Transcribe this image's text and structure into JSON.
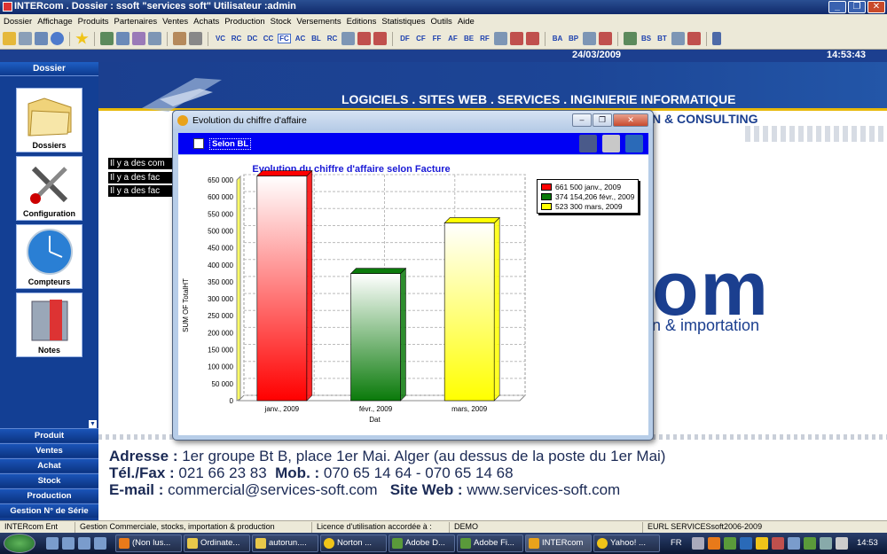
{
  "window": {
    "title": "INTERcom  . Dossier : ssoft  \"services soft\"  Utilisateur :admin",
    "controls": [
      "_",
      "❐",
      "✕"
    ]
  },
  "menu": [
    "Dossier",
    "Affichage",
    "Produits",
    "Partenaires",
    "Ventes",
    "Achats",
    "Production",
    "Stock",
    "Versements",
    "Editions",
    "Statistiques",
    "Outils",
    "Aide"
  ],
  "toolbar": {
    "labels": [
      "VC",
      "RC",
      "DC",
      "CC",
      "FC",
      "AC",
      "BL",
      "RC",
      "DF",
      "CF",
      "FF",
      "AF",
      "BE",
      "RF",
      "BA",
      "BP",
      "BS",
      "BT"
    ]
  },
  "header": {
    "date": "24/03/2009",
    "time": "14:53:43"
  },
  "sidebar": {
    "title": "Dossier",
    "tiles": [
      {
        "label": "Dossiers"
      },
      {
        "label": "Configuration"
      },
      {
        "label": "Compteurs"
      },
      {
        "label": "Notes"
      }
    ],
    "buttons": [
      "Produit",
      "Ventes",
      "Achat",
      "Stock",
      "Production",
      "Gestion N° de Série"
    ],
    "collapse": "▼"
  },
  "banner": {
    "slogan1": "LOGICIELS . SITES WEB . SERVICES . INGINIERIE INFORMATIQUE",
    "slogan2": "N & CONSULTING",
    "logo": "om",
    "subtitle": "n & importation"
  },
  "alerts": [
    "Il y a des com",
    "Il y a des fac",
    "Il y a des fac"
  ],
  "footer": {
    "address_label": "Adresse :",
    "address": "1er groupe Bt B, place 1er Mai. Alger (au dessus de la poste du 1er Mai)",
    "tel_label": "Tél./Fax :",
    "tel": "021 66 23 83",
    "mob_label": "Mob. :",
    "mob": "070 65 14 64 - 070 65 14 68",
    "email_label": "E-mail :",
    "email": "commercial@services-soft.com",
    "web_label": "Site Web :",
    "web": "www.services-soft.com"
  },
  "dialog": {
    "title": "Evolution du chiffre d'affaire",
    "checkbox_label": "Selon BL",
    "checkbox_checked": false,
    "controls": [
      "–",
      "❐",
      "✕"
    ]
  },
  "chart_data": {
    "type": "bar",
    "title": "Evolution du chiffre d'affaire selon Facture",
    "xlabel": "Dat",
    "ylabel": "SUM OF TotalHT",
    "categories": [
      "janv., 2009",
      "févr., 2009",
      "mars, 2009"
    ],
    "values": [
      661500,
      374154.206,
      523300
    ],
    "colors": [
      "#ff0000",
      "#0a7a0a",
      "#ffff00"
    ],
    "ylim": [
      0,
      650000
    ],
    "yticks": [
      "0",
      "50 000",
      "100 000",
      "150 000",
      "200 000",
      "250 000",
      "300 000",
      "350 000",
      "400 000",
      "450 000",
      "500 000",
      "550 000",
      "600 000",
      "650 000"
    ],
    "legend": [
      "661 500 janv., 2009",
      "374 154,206 févr., 2009",
      "523 300 mars, 2009"
    ],
    "legend_position": "top-right",
    "grid": true
  },
  "statusbar": [
    "INTERcom Ent",
    "Gestion Commerciale, stocks, importation & production",
    "Licence d'utilisation accordée à :",
    "DEMO",
    "EURL SERVICESsoft2006-2009"
  ],
  "taskbar": {
    "tasks": [
      "(Non lus...",
      "Ordinate...",
      "autorun....",
      "Norton ...",
      "Adobe D...",
      "Adobe Fi...",
      "INTERcom",
      "Yahoo! ..."
    ],
    "lang": "FR",
    "clock": "14:53"
  }
}
